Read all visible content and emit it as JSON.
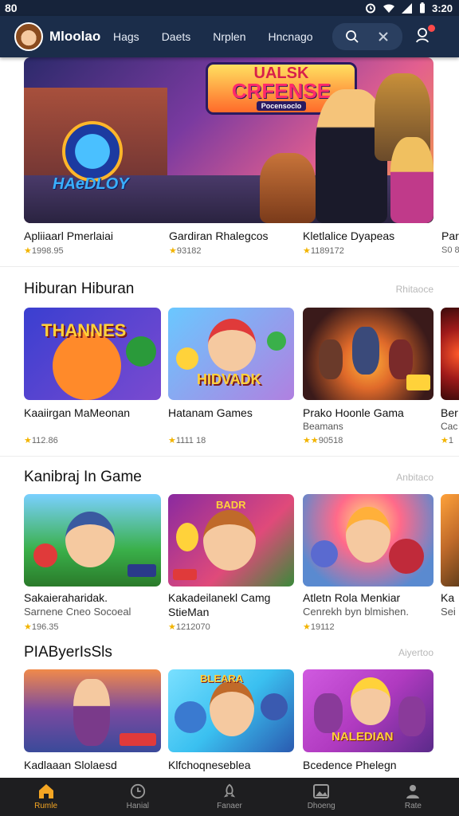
{
  "status_bar": {
    "left": "80",
    "time": "3:20"
  },
  "header": {
    "brand": "Mloolao",
    "nav": [
      "Hags",
      "Daets",
      "Nrplen",
      "Hncnago"
    ]
  },
  "hero": {
    "logo_line1": "UALSK",
    "logo_line2": "CRFENSE",
    "logo_sub": "Pocensoclo",
    "badge_text": "HAeDLOY",
    "items": [
      {
        "title": "Apliiaarl Pmerlaiai",
        "rating": "1998.95"
      },
      {
        "title": "Gardiran Rhalegcos",
        "rating": "93182"
      },
      {
        "title": "Kletlalice Dyapeas",
        "rating": "1189172"
      },
      {
        "title": "Par",
        "rating": "S0 8"
      }
    ]
  },
  "sections": [
    {
      "title": "Hiburan Hiburan",
      "more": "Rhitaoce",
      "cards": [
        {
          "title": "Kaaiirgan MaMeonan",
          "sub": "",
          "rating": "112.86",
          "art": "THANNES",
          "colors": [
            "#3a3fd0",
            "#ff8a2a",
            "#2a8a3a"
          ]
        },
        {
          "title": "Hatanam Games",
          "sub": "",
          "rating": "1111 18",
          "art": "HIDVADK",
          "colors": [
            "#5ab0ff",
            "#e03a3a",
            "#ffd23a"
          ]
        },
        {
          "title": "Prako Hoonle Gama",
          "sub": "Beamans",
          "rating": "90518",
          "art": "",
          "colors": [
            "#3a1a1a",
            "#e06a2a",
            "#ffb03a"
          ]
        },
        {
          "title": "Ber",
          "sub": "Cac",
          "rating": "1",
          "art": "",
          "colors": [
            "#a01a1a",
            "#ff5a2a",
            "#3a0a0a"
          ]
        }
      ]
    },
    {
      "title": "Kanibraj In Game",
      "more": "Anbitaco",
      "cards": [
        {
          "title": "Sakaieraharidak.",
          "sub": "Sarnene Cneo Socoeal",
          "rating": "196.35",
          "art": "",
          "colors": [
            "#2a9a3a",
            "#ffc23a",
            "#5a3a2a"
          ]
        },
        {
          "title": "Kakadeilanekl Camg",
          "sub": "StieMan",
          "rating": "1212070",
          "art": "BADR",
          "colors": [
            "#8a2aa0",
            "#ff8a3a",
            "#3a8a3a"
          ]
        },
        {
          "title": "Atletn Rola Menkiar",
          "sub": "Cenrekh byn blmishen.",
          "rating": "19112",
          "art": "",
          "colors": [
            "#5a8ad0",
            "#ff6a8a",
            "#ffd23a"
          ]
        },
        {
          "title": "Ka",
          "sub": "Sei",
          "rating": "",
          "art": "",
          "colors": [
            "#c06a2a",
            "#ffa23a",
            "#5a3a1a"
          ]
        }
      ]
    },
    {
      "title": "PIAByerIsSls",
      "more": "Aiyertoo",
      "cards": [
        {
          "title": "Kadlaaan Slolaesd",
          "sub": "",
          "rating": "",
          "art": "",
          "colors": [
            "#3a4a9a",
            "#f08a4a",
            "#2a6a3a"
          ]
        },
        {
          "title": "Klfchoqneseblea",
          "sub": "",
          "rating": "",
          "art": "BLEARA",
          "colors": [
            "#3ac0f0",
            "#ff7a2a",
            "#2a5ab0"
          ]
        },
        {
          "title": "Bcedence Phelegn",
          "sub": "",
          "rating": "",
          "art": "NALEDIAN",
          "colors": [
            "#b03ac0",
            "#ffd23a",
            "#5a2a8a"
          ]
        }
      ]
    }
  ],
  "bottom_nav": [
    {
      "label": "Rumle",
      "icon": "home-icon",
      "active": true
    },
    {
      "label": "Hanial",
      "icon": "clock-icon",
      "active": false
    },
    {
      "label": "Fanaer",
      "icon": "rocket-icon",
      "active": false
    },
    {
      "label": "Dhoeng",
      "icon": "image-icon",
      "active": false
    },
    {
      "label": "Rate",
      "icon": "profile-icon",
      "active": false
    }
  ],
  "colors": {
    "header": "#1b2d4a",
    "accent": "#f5a623",
    "bottom_nav": "#1e1e20"
  }
}
